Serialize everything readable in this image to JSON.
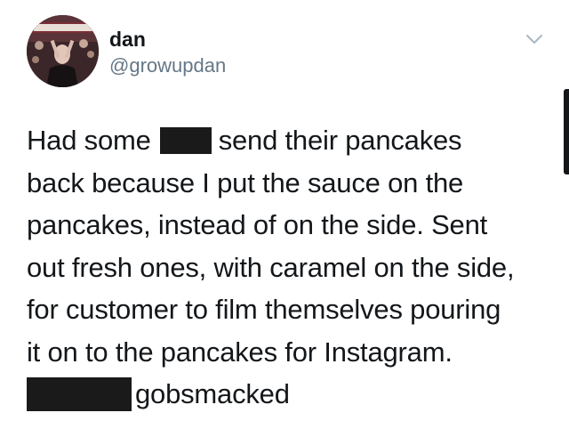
{
  "header": {
    "display_name": "dan",
    "handle": "@growupdan",
    "avatar_icon": "profile-photo-icon",
    "menu_icon": "chevron-down-icon"
  },
  "tweet": {
    "lines": [
      {
        "before": "Had some",
        "redacted": true,
        "after": "send their pancakes"
      },
      {
        "text": "back because I put the sauce on the"
      },
      {
        "text": "pancakes, instead of on the side. Sent"
      },
      {
        "text": "out fresh ones, with caramel on the side,"
      },
      {
        "text": "for customer to film themselves pouring"
      },
      {
        "text": "it on to the pancakes for Instagram."
      },
      {
        "before": "",
        "redacted": true,
        "after": "gobsmacked"
      }
    ]
  },
  "colors": {
    "text": "#14171a",
    "handle": "#657786",
    "redaction": "#1a1a1a",
    "chevron": "#aab8c2"
  }
}
